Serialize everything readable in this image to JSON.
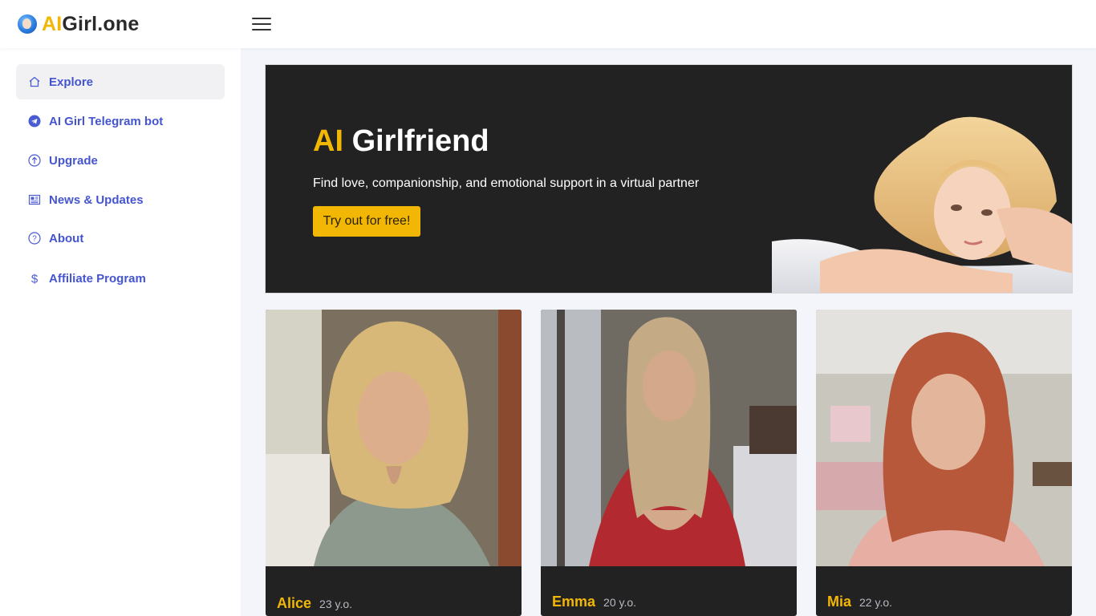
{
  "brand": {
    "accent": "AI",
    "rest": "Girl.one"
  },
  "header": {
    "menu_icon": "hamburger-icon"
  },
  "sidebar": {
    "items": [
      {
        "label": "Explore",
        "icon": "home-icon",
        "active": true
      },
      {
        "label": "AI Girl Telegram bot",
        "icon": "telegram-icon",
        "active": false
      },
      {
        "label": "Upgrade",
        "icon": "arrow-up-circle-icon",
        "active": false
      },
      {
        "label": "News & Updates",
        "icon": "newspaper-icon",
        "active": false
      },
      {
        "label": "About",
        "icon": "question-circle-icon",
        "active": false
      },
      {
        "label": "Affiliate Program",
        "icon": "dollar-icon",
        "active": false
      }
    ]
  },
  "hero": {
    "title_accent": "AI",
    "title_rest": "Girlfriend",
    "subtitle": "Find love, companionship, and emotional support in a virtual partner",
    "cta": "Try out for free!"
  },
  "cards": [
    {
      "name": "Alice",
      "age": "23 y.o."
    },
    {
      "name": "Emma",
      "age": "20 y.o."
    },
    {
      "name": "Mia",
      "age": "22 y.o."
    }
  ],
  "colors": {
    "accent": "#f2b705",
    "nav_text": "#4555cf",
    "hero_bg": "#222222",
    "page_bg": "#f3f5fa"
  }
}
